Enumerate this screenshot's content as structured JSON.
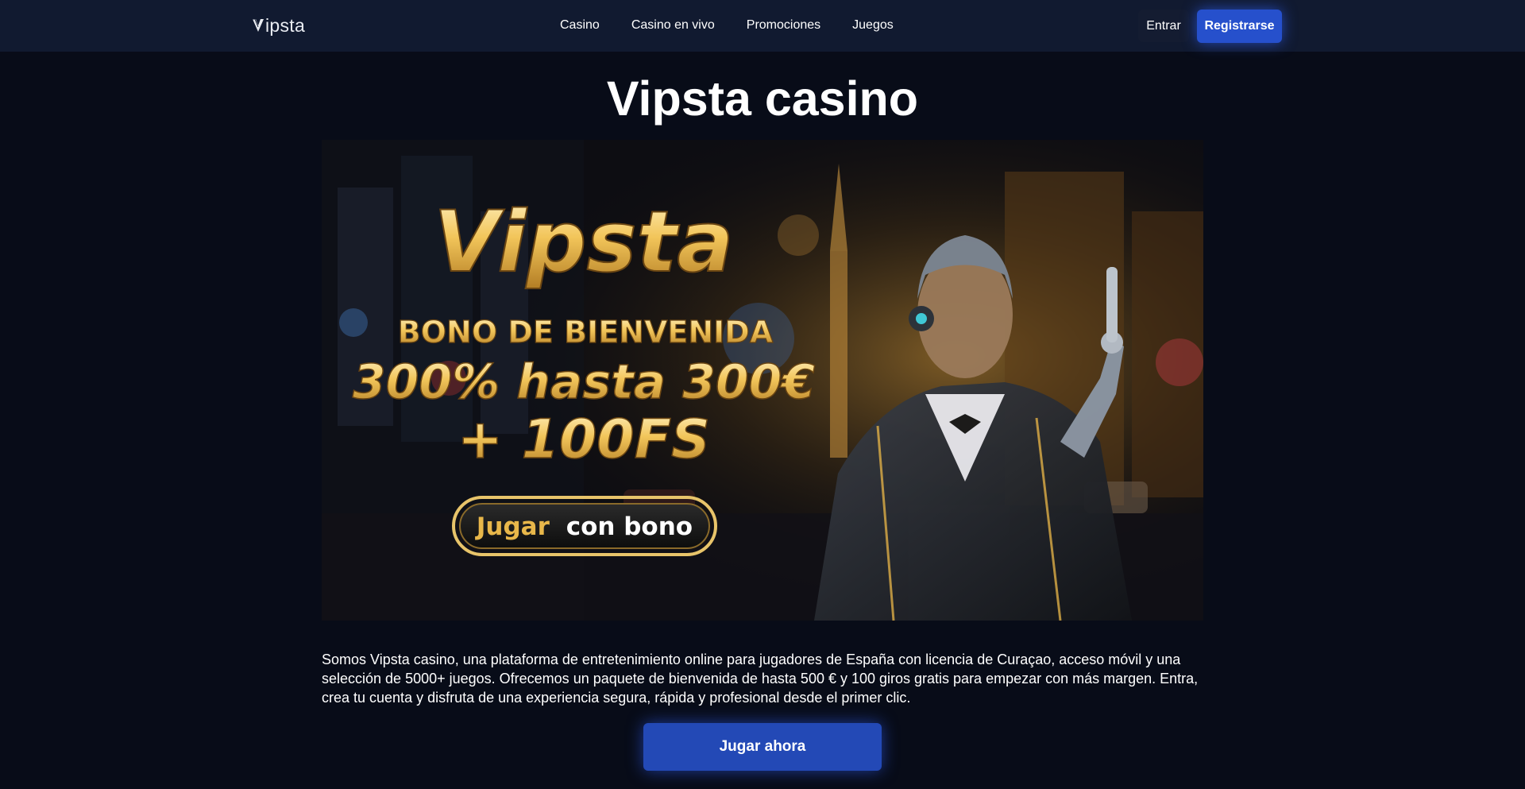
{
  "header": {
    "logo_text": "ipsta",
    "nav": [
      "Casino",
      "Casino en vivo",
      "Promociones",
      "Juegos"
    ],
    "login_label": "Entrar",
    "register_label": "Registrarse"
  },
  "main": {
    "title": "Vipsta casino",
    "banner": {
      "brand": "Vipsta",
      "headline": "BONO DE BIENVENIDA",
      "offer_line1": "300% hasta 300€",
      "offer_line2": "+ 100FS",
      "cta_word1": "Jugar",
      "cta_word2": "con bono"
    },
    "intro": "Somos Vipsta casino, una plataforma de entretenimiento online para jugadores de España con licencia de Curaçao, acceso móvil y una selección de 5000+ juegos. Ofrecemos un paquete de bienvenida de hasta 500 € y 100 giros gratis para empezar con más margen. Entra, crea tu cuenta y disfruta de una experiencia segura, rápida y profesional desde el primer clic.",
    "play_label": "Jugar ahora"
  },
  "colors": {
    "background": "#080c18",
    "header": "#111a30",
    "accent": "#2650cc",
    "gold": "#e8b74a"
  }
}
